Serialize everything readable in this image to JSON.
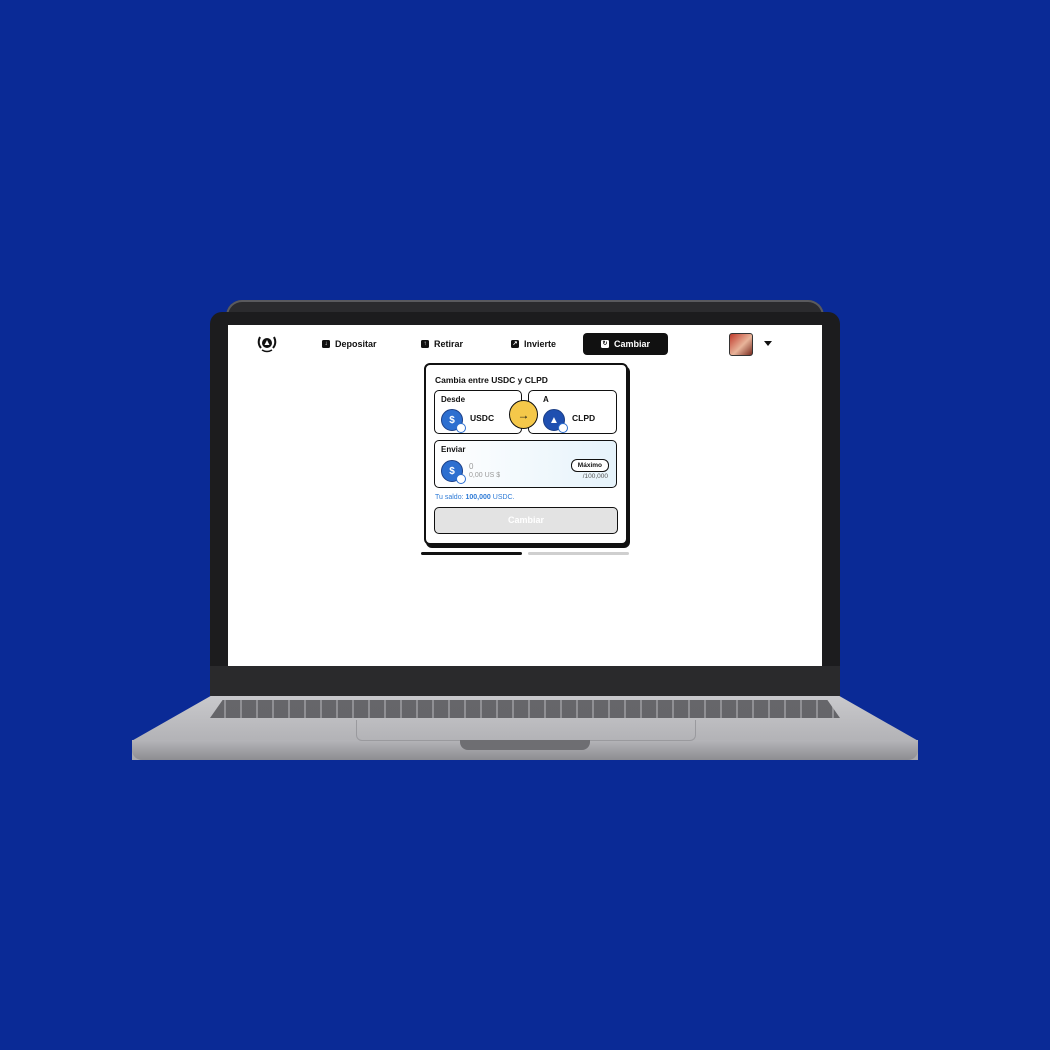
{
  "nav": {
    "items": [
      {
        "label": "Depositar",
        "icon": "download-icon"
      },
      {
        "label": "Retirar",
        "icon": "upload-icon"
      },
      {
        "label": "Invierte",
        "icon": "arrow-up-right-icon"
      },
      {
        "label": "Cambiar",
        "icon": "swap-icon",
        "active": true
      }
    ]
  },
  "swap_card": {
    "title": "Cambia entre USDC y CLPD",
    "from_label": "Desde",
    "from_token": "USDC",
    "to_label": "A",
    "to_token": "CLPD",
    "send_label": "Enviar",
    "send_token": "USDC",
    "amount_value": "0",
    "amount_usd": "0,00 US $",
    "max_label": "Máximo",
    "limit": "/100,000",
    "balance_prefix": "Tu saldo:",
    "balance_value": "100,000",
    "balance_unit": "USDC.",
    "submit_label": "Cambiar"
  },
  "progress": {
    "steps_total": 2,
    "current_step": 1
  },
  "colors": {
    "background": "#0a2a96",
    "accent_yellow": "#f5c84a",
    "token_blue": "#2d6fd0",
    "balance_text": "#2d7ad6"
  }
}
